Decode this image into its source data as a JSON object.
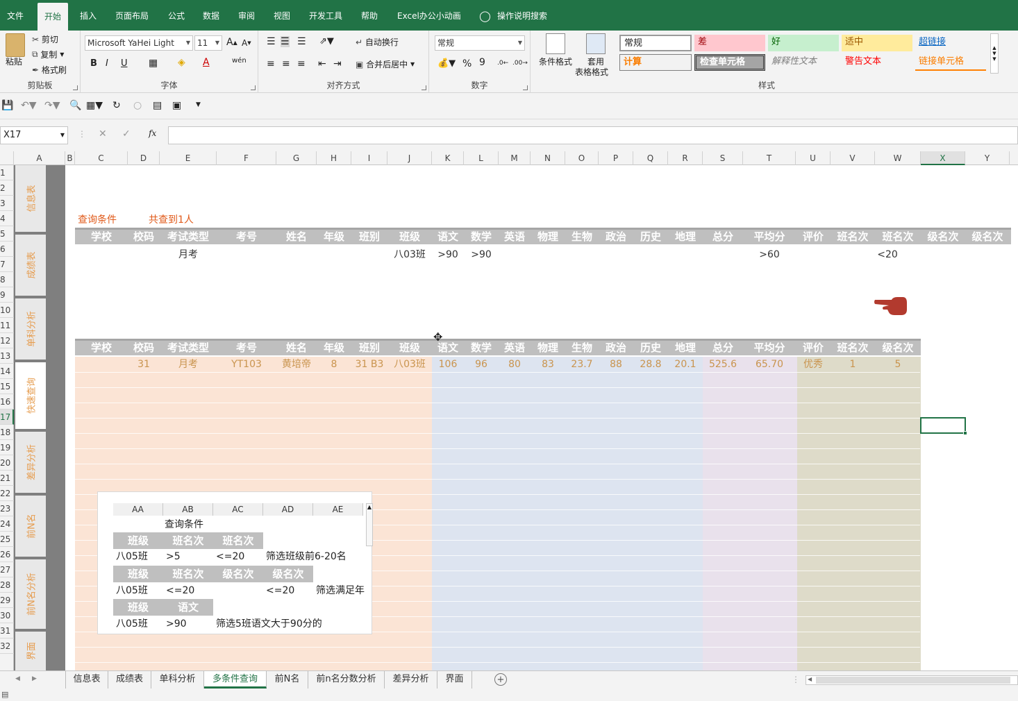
{
  "menu": {
    "file": "文件",
    "home": "开始",
    "insert": "插入",
    "layout": "页面布局",
    "formulas": "公式",
    "data": "数据",
    "review": "审阅",
    "view": "视图",
    "developer": "开发工具",
    "help": "帮助",
    "addin": "Excel办公小动画",
    "search": "操作说明搜索"
  },
  "ribbon": {
    "clipboard": {
      "paste": "粘贴",
      "cut": "剪切",
      "copy": "复制",
      "format_painter": "格式刷",
      "label": "剪贴板"
    },
    "font": {
      "name": "Microsoft YaHei Light",
      "size": "11",
      "bold": "B",
      "italic": "I",
      "underline": "U",
      "label": "字体",
      "grow": "A",
      "shrink": "A",
      "color_a": "A",
      "wen": "wén"
    },
    "alignment": {
      "wrap": "自动换行",
      "merge": "合并后居中",
      "label": "对齐方式"
    },
    "number": {
      "format": "常规",
      "percent": "%",
      "comma": "9",
      "label": "数字"
    },
    "styles": {
      "cond_format": "条件格式",
      "table_format_1": "套用",
      "table_format_2": "表格格式",
      "normal": "常规",
      "bad": "差",
      "good": "好",
      "neutral": "适中",
      "hyperlink": "超链接",
      "calculation": "计算",
      "check_cell": "检查单元格",
      "explanatory": "解释性文本",
      "warning": "警告文本",
      "linked_cell": "链接单元格",
      "label": "样式"
    }
  },
  "name_box": "X17",
  "fx": "fx",
  "columns": [
    "A",
    "B",
    "C",
    "D",
    "E",
    "F",
    "G",
    "H",
    "I",
    "J",
    "K",
    "L",
    "M",
    "N",
    "O",
    "P",
    "Q",
    "R",
    "S",
    "T",
    "U",
    "V",
    "W",
    "X",
    "Y"
  ],
  "rows": [
    "1",
    "2",
    "3",
    "4",
    "5",
    "6",
    "7",
    "8",
    "9",
    "10",
    "11",
    "12",
    "13",
    "14",
    "15",
    "16",
    "17",
    "18",
    "19",
    "20",
    "21",
    "22",
    "23",
    "24",
    "25",
    "26",
    "27",
    "28",
    "29",
    "30",
    "31",
    "32"
  ],
  "side_tabs": [
    "信息表",
    "成绩表",
    "单科分析",
    "快速查询",
    "差异分析",
    "前N名",
    "前N名分析",
    "界面"
  ],
  "query": {
    "label": "查询条件",
    "result": "共查到1人",
    "headers": [
      "学校",
      "校码",
      "考试类型",
      "考号",
      "姓名",
      "年级",
      "班别",
      "班级",
      "语文",
      "数学",
      "英语",
      "物理",
      "生物",
      "政治",
      "历史",
      "地理",
      "总分",
      "平均分",
      "评价",
      "班名次",
      "班名次",
      "级名次",
      "级名次"
    ],
    "exam_type": "月考",
    "class": "八03班",
    "chinese": ">90",
    "math": ">90",
    "avg": ">60",
    "rank": "<20"
  },
  "result": {
    "headers": [
      "学校",
      "校码",
      "考试类型",
      "考号",
      "姓名",
      "年级",
      "班别",
      "班级",
      "语文",
      "数学",
      "英语",
      "物理",
      "生物",
      "政治",
      "历史",
      "地理",
      "总分",
      "平均分",
      "评价",
      "班名次",
      "级名次"
    ],
    "row": [
      "",
      "31",
      "月考",
      "YT103",
      "黄培帝",
      "8",
      "31 B3",
      "八03班",
      "106",
      "96",
      "80",
      "83",
      "23.7",
      "88",
      "28.8",
      "20.1",
      "525.6",
      "65.70",
      "优秀",
      "1",
      "5"
    ]
  },
  "float_panel": {
    "cols": [
      "AA",
      "AB",
      "AC",
      "AD",
      "AE"
    ],
    "title": "查询条件",
    "g1": [
      "班级",
      "班名次",
      "班名次"
    ],
    "r1": [
      "八05班",
      ">5",
      "<=20",
      "筛选班级前6-20名"
    ],
    "g2": [
      "班级",
      "班名次",
      "级名次",
      "级名次"
    ],
    "r2": [
      "八05班",
      "<=20",
      "<=20",
      "筛选满足年"
    ],
    "g3": [
      "班级",
      "语文"
    ],
    "r3": [
      "八05班",
      ">90",
      "筛选5班语文大于90分的"
    ]
  },
  "sheet_tabs": [
    "信息表",
    "成绩表",
    "单科分析",
    "多条件查询",
    "前N名",
    "前n名分数分析",
    "差异分析",
    "界面"
  ],
  "colors": {
    "accent": "#217346",
    "orange_text": "#e05a1a",
    "header_gray": "#bfbfbf"
  }
}
